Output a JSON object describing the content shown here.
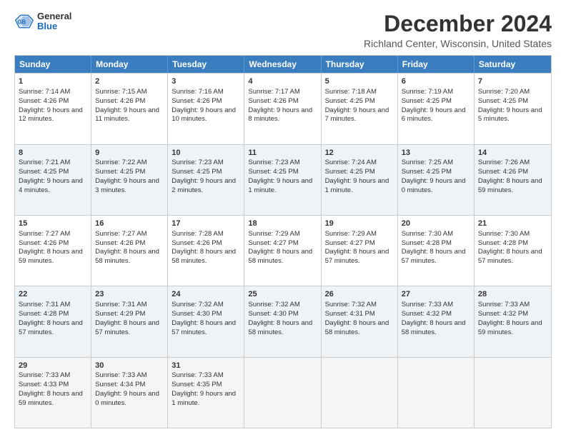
{
  "header": {
    "logo_general": "General",
    "logo_blue": "Blue",
    "month_title": "December 2024",
    "location": "Richland Center, Wisconsin, United States"
  },
  "calendar": {
    "days": [
      "Sunday",
      "Monday",
      "Tuesday",
      "Wednesday",
      "Thursday",
      "Friday",
      "Saturday"
    ],
    "weeks": [
      [
        {
          "num": "",
          "empty": true
        },
        {
          "num": "2",
          "sunrise": "7:15 AM",
          "sunset": "4:26 PM",
          "daylight": "9 hours and 11 minutes."
        },
        {
          "num": "3",
          "sunrise": "7:16 AM",
          "sunset": "4:26 PM",
          "daylight": "9 hours and 10 minutes."
        },
        {
          "num": "4",
          "sunrise": "7:17 AM",
          "sunset": "4:26 PM",
          "daylight": "9 hours and 8 minutes."
        },
        {
          "num": "5",
          "sunrise": "7:18 AM",
          "sunset": "4:25 PM",
          "daylight": "9 hours and 7 minutes."
        },
        {
          "num": "6",
          "sunrise": "7:19 AM",
          "sunset": "4:25 PM",
          "daylight": "9 hours and 6 minutes."
        },
        {
          "num": "7",
          "sunrise": "7:20 AM",
          "sunset": "4:25 PM",
          "daylight": "9 hours and 5 minutes."
        }
      ],
      [
        {
          "num": "1",
          "sunrise": "7:14 AM",
          "sunset": "4:26 PM",
          "daylight": "9 hours and 12 minutes.",
          "first": true
        },
        {
          "num": "8",
          "sunrise": "7:21 AM",
          "sunset": "4:25 PM",
          "daylight": "9 hours and 4 minutes."
        },
        {
          "num": "9",
          "sunrise": "7:22 AM",
          "sunset": "4:25 PM",
          "daylight": "9 hours and 3 minutes."
        },
        {
          "num": "10",
          "sunrise": "7:23 AM",
          "sunset": "4:25 PM",
          "daylight": "9 hours and 2 minutes."
        },
        {
          "num": "11",
          "sunrise": "7:23 AM",
          "sunset": "4:25 PM",
          "daylight": "9 hours and 1 minute."
        },
        {
          "num": "12",
          "sunrise": "7:24 AM",
          "sunset": "4:25 PM",
          "daylight": "9 hours and 1 minute."
        },
        {
          "num": "13",
          "sunrise": "7:25 AM",
          "sunset": "4:25 PM",
          "daylight": "9 hours and 0 minutes."
        },
        {
          "num": "14",
          "sunrise": "7:26 AM",
          "sunset": "4:26 PM",
          "daylight": "8 hours and 59 minutes."
        }
      ],
      [
        {
          "num": "15",
          "sunrise": "7:27 AM",
          "sunset": "4:26 PM",
          "daylight": "8 hours and 59 minutes."
        },
        {
          "num": "16",
          "sunrise": "7:27 AM",
          "sunset": "4:26 PM",
          "daylight": "8 hours and 58 minutes."
        },
        {
          "num": "17",
          "sunrise": "7:28 AM",
          "sunset": "4:26 PM",
          "daylight": "8 hours and 58 minutes."
        },
        {
          "num": "18",
          "sunrise": "7:29 AM",
          "sunset": "4:27 PM",
          "daylight": "8 hours and 58 minutes."
        },
        {
          "num": "19",
          "sunrise": "7:29 AM",
          "sunset": "4:27 PM",
          "daylight": "8 hours and 57 minutes."
        },
        {
          "num": "20",
          "sunrise": "7:30 AM",
          "sunset": "4:28 PM",
          "daylight": "8 hours and 57 minutes."
        },
        {
          "num": "21",
          "sunrise": "7:30 AM",
          "sunset": "4:28 PM",
          "daylight": "8 hours and 57 minutes."
        }
      ],
      [
        {
          "num": "22",
          "sunrise": "7:31 AM",
          "sunset": "4:28 PM",
          "daylight": "8 hours and 57 minutes."
        },
        {
          "num": "23",
          "sunrise": "7:31 AM",
          "sunset": "4:29 PM",
          "daylight": "8 hours and 57 minutes."
        },
        {
          "num": "24",
          "sunrise": "7:32 AM",
          "sunset": "4:30 PM",
          "daylight": "8 hours and 57 minutes."
        },
        {
          "num": "25",
          "sunrise": "7:32 AM",
          "sunset": "4:30 PM",
          "daylight": "8 hours and 58 minutes."
        },
        {
          "num": "26",
          "sunrise": "7:32 AM",
          "sunset": "4:31 PM",
          "daylight": "8 hours and 58 minutes."
        },
        {
          "num": "27",
          "sunrise": "7:33 AM",
          "sunset": "4:32 PM",
          "daylight": "8 hours and 58 minutes."
        },
        {
          "num": "28",
          "sunrise": "7:33 AM",
          "sunset": "4:32 PM",
          "daylight": "8 hours and 59 minutes."
        }
      ],
      [
        {
          "num": "29",
          "sunrise": "7:33 AM",
          "sunset": "4:33 PM",
          "daylight": "8 hours and 59 minutes."
        },
        {
          "num": "30",
          "sunrise": "7:33 AM",
          "sunset": "4:34 PM",
          "daylight": "9 hours and 0 minutes."
        },
        {
          "num": "31",
          "sunrise": "7:33 AM",
          "sunset": "4:35 PM",
          "daylight": "9 hours and 1 minute."
        },
        {
          "num": "",
          "empty": true
        },
        {
          "num": "",
          "empty": true
        },
        {
          "num": "",
          "empty": true
        },
        {
          "num": "",
          "empty": true
        }
      ]
    ]
  }
}
